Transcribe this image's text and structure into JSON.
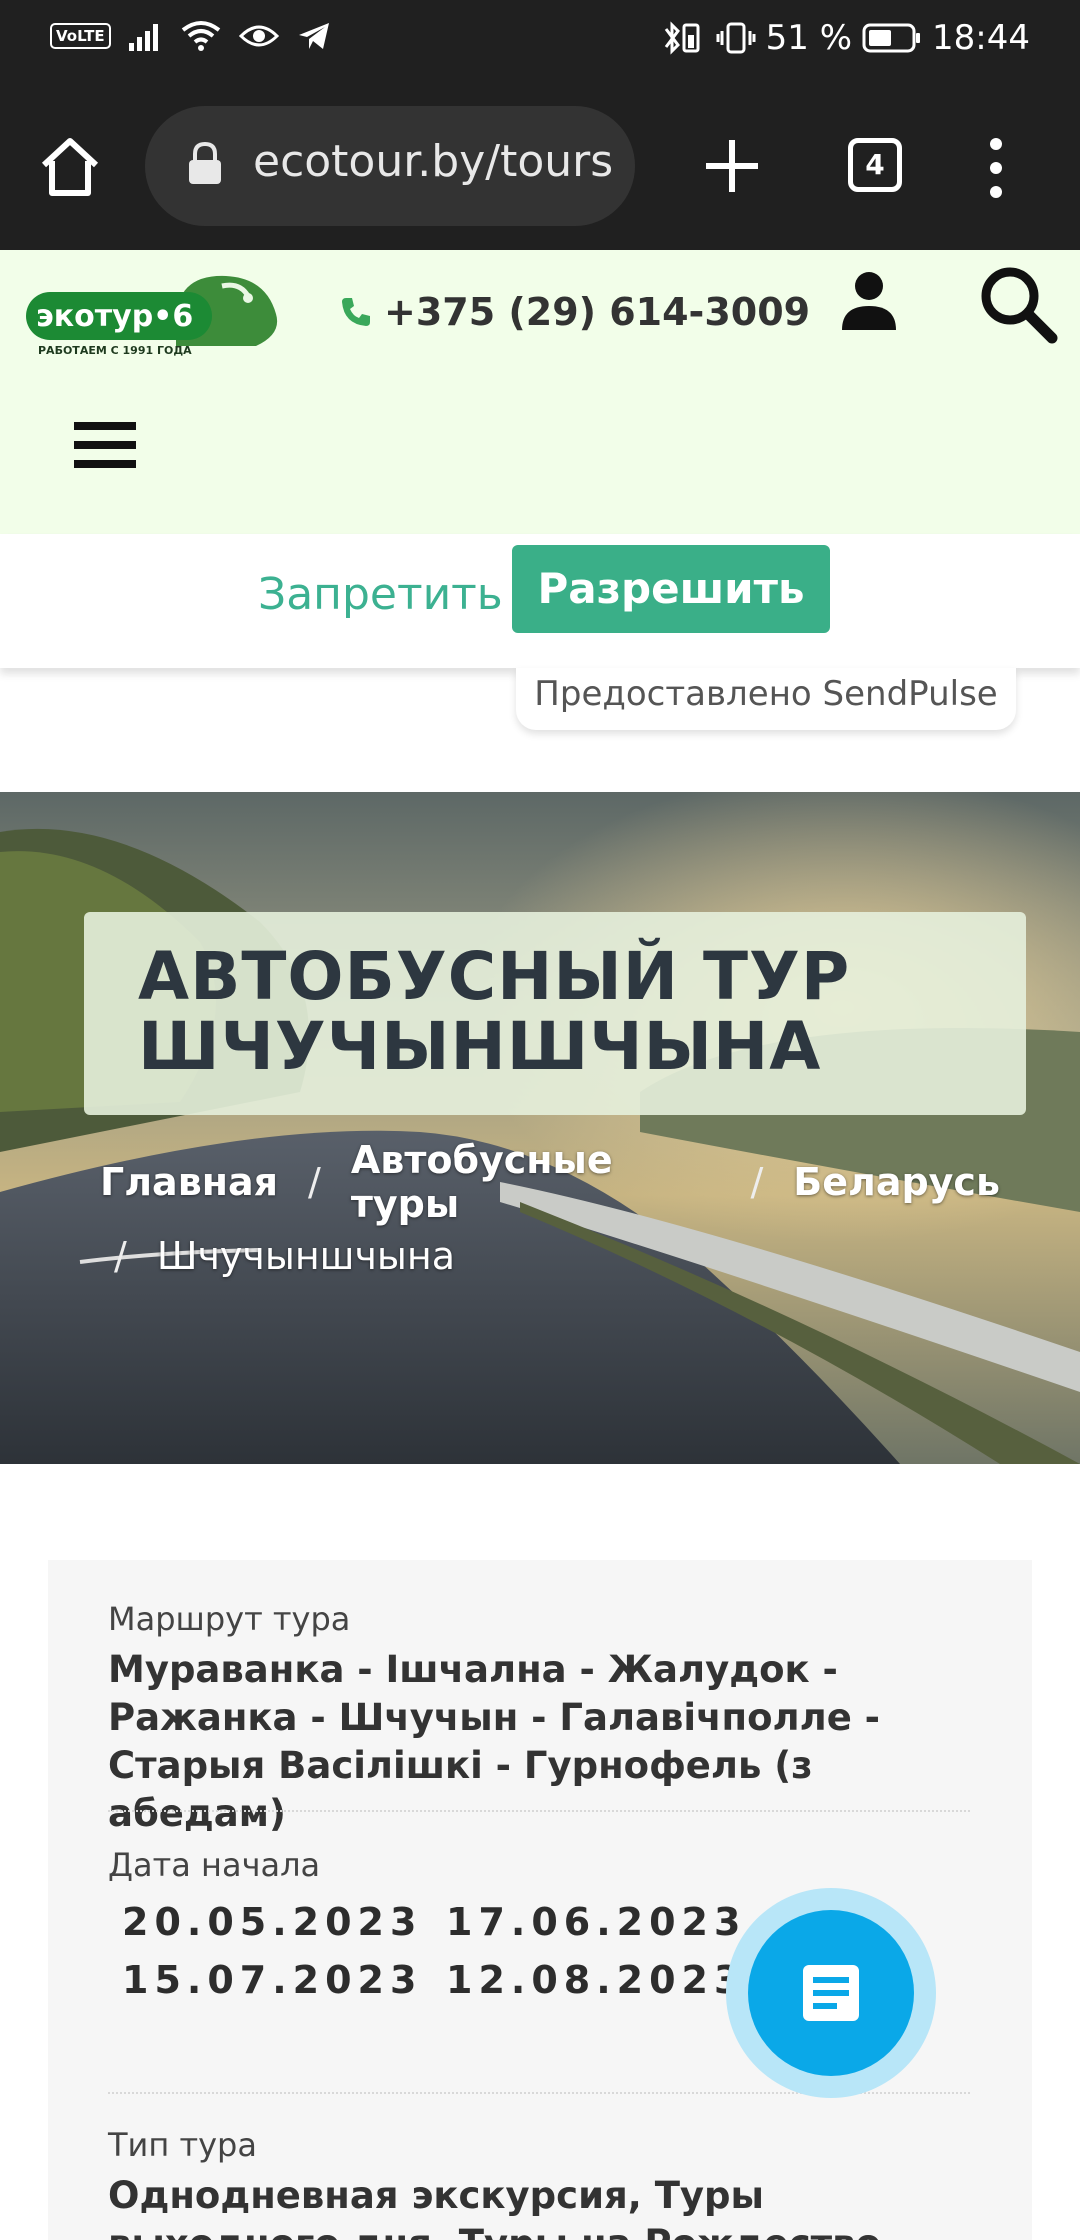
{
  "status_bar": {
    "volte": "VoLTE",
    "battery": "51 %",
    "time": "18:44"
  },
  "browser": {
    "url": "ecotour.by/tours",
    "tab_count": "4"
  },
  "header": {
    "logo_text": "экотур",
    "logo_tagline": "РАБОТАЕМ С 1991 ГОДА",
    "phone": "+375 (29) 614-3009"
  },
  "consent": {
    "deny_label": "Запретить",
    "allow_label": "Разрешить",
    "provider_note": "Предоставлено SendPulse"
  },
  "hero": {
    "title_line1": "АВТОБУСНЫЙ ТУР",
    "title_line2": "ШЧУЧЫНШЧЫНА",
    "breadcrumbs": [
      "Главная",
      "Автобусные туры",
      "Беларусь",
      "Шчучыншчына"
    ]
  },
  "tour": {
    "route_label": "Маршрут тура",
    "route_value": "Мураванка - Ішчална - Жалудок - Ражанка - Шчучын - Галавічполле - Старыя Васілішкі - Гурнофель (з абедам)",
    "start_label": "Дата начала",
    "dates": [
      "20.05.2023",
      "17.06.2023",
      "15.07.2023",
      "12.08.2023"
    ],
    "type_label": "Тип тура",
    "type_value": "Однодневная экскурсия, Туры выходного дня, Туры на Рождество, Экскурсионные"
  },
  "colors": {
    "header_bg": "#f2fee9",
    "accent_green": "#3aaf88",
    "fab_blue": "#0aa8e8"
  }
}
